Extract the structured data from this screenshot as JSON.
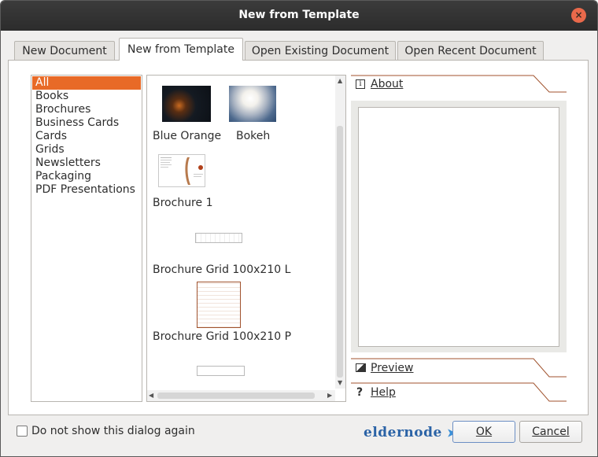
{
  "window": {
    "title": "New from Template",
    "close_glyph": "×"
  },
  "tabs": [
    {
      "label": "New Document",
      "active": false
    },
    {
      "label": "New from Template",
      "active": true
    },
    {
      "label": "Open Existing Document",
      "active": false
    },
    {
      "label": "Open Recent Document",
      "active": false
    }
  ],
  "categories": [
    "All",
    "Books",
    "Brochures",
    "Business Cards",
    "Cards",
    "Grids",
    "Newsletters",
    "Packaging",
    "PDF Presentations"
  ],
  "selected_category": "All",
  "templates": [
    {
      "label": "Blue Orange",
      "thumb": "dark-photo"
    },
    {
      "label": "Bokeh",
      "thumb": "bokeh-photo"
    },
    {
      "label": "Brochure 1",
      "thumb": "brochure-doc"
    },
    {
      "label": "Brochure Grid 100x210 L",
      "thumb": "landscape-grid"
    },
    {
      "label": "Brochure Grid 100x210 P",
      "thumb": "portrait-grid"
    }
  ],
  "side": {
    "about_label": "About",
    "preview_label": "Preview",
    "help_label": "Help",
    "about_icon": "info-icon",
    "preview_icon": "image-icon",
    "help_icon": "question-icon"
  },
  "footer": {
    "checkbox_label": "Do not show this dialog again",
    "checked": false,
    "logo_text": "eldernode",
    "ok_label": "OK",
    "cancel_label": "Cancel"
  },
  "colors": {
    "selection": "#e86a27",
    "titlebar": "#2c2c2c",
    "close": "#e9694b",
    "logo": "#2b63a6"
  }
}
